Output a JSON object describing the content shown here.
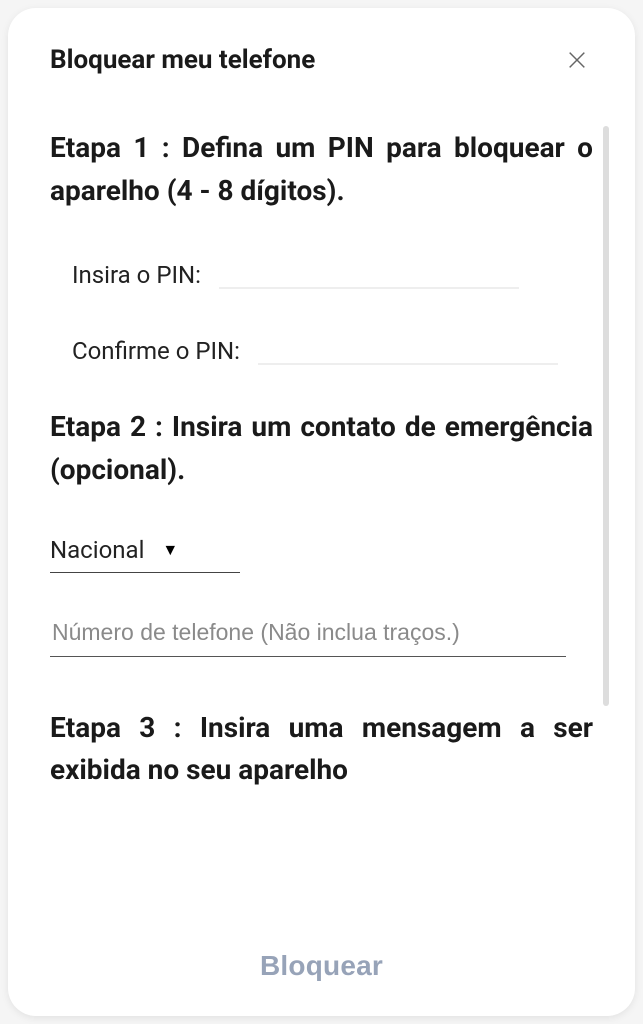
{
  "header": {
    "title": "Bloquear meu telefone"
  },
  "step1": {
    "heading": "Etapa 1 : Defina um PIN para bloquear o aparelho (4 - 8 dígitos).",
    "enter_pin_label": "Insira o PIN:",
    "confirm_pin_label": "Confirme o PIN:"
  },
  "step2": {
    "heading": "Etapa 2 : Insira um contato de emergência (opcional).",
    "country_select": "Nacional",
    "phone_placeholder": "Número de telefone (Não inclua traços.)"
  },
  "step3": {
    "heading": "Etapa 3 : Insira uma mensagem a ser exibida no seu aparelho"
  },
  "footer": {
    "block_label": "Bloquear"
  }
}
